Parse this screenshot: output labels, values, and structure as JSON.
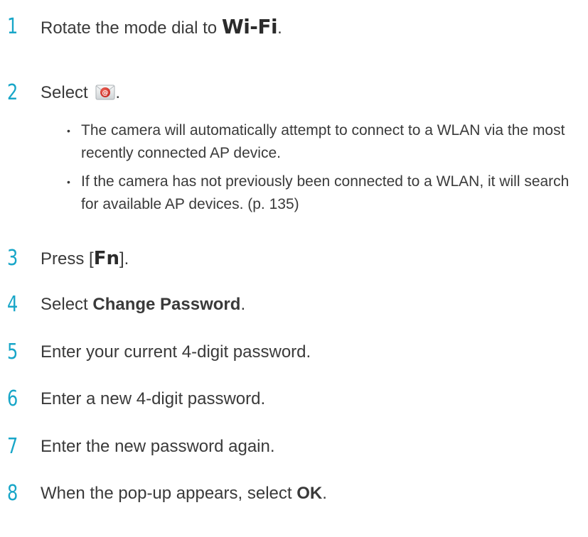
{
  "steps": [
    {
      "num": "1",
      "text": "Rotate the mode dial to ",
      "highlight": "Wi-Fi",
      "after": "."
    },
    {
      "num": "2",
      "text": "Select ",
      "icon": "email-icon",
      "after": "."
    },
    {
      "num": "3",
      "before": "Press [",
      "highlight": "Fn",
      "after": "]."
    },
    {
      "num": "4",
      "before": "Select ",
      "bold": "Change Password",
      "after": "."
    },
    {
      "num": "5",
      "text": "Enter your current 4-digit password."
    },
    {
      "num": "6",
      "text": "Enter a new 4-digit password."
    },
    {
      "num": "7",
      "text": "Enter the new password again."
    },
    {
      "num": "8",
      "before": "When the pop-up appears, select ",
      "bold": "OK",
      "after": "."
    }
  ],
  "bullets": [
    {
      "dot": "•",
      "text": "The camera will automatically attempt to connect to a WLAN via the most recently connected AP device."
    },
    {
      "dot": "•",
      "text": "If the camera has not previously been connected to a WLAN, it will search for available AP devices. (p. 135)"
    }
  ],
  "colors": {
    "step_number": "#18a6c8",
    "body_text": "#3a3a3a",
    "email_icon_red": "#d9302a"
  }
}
